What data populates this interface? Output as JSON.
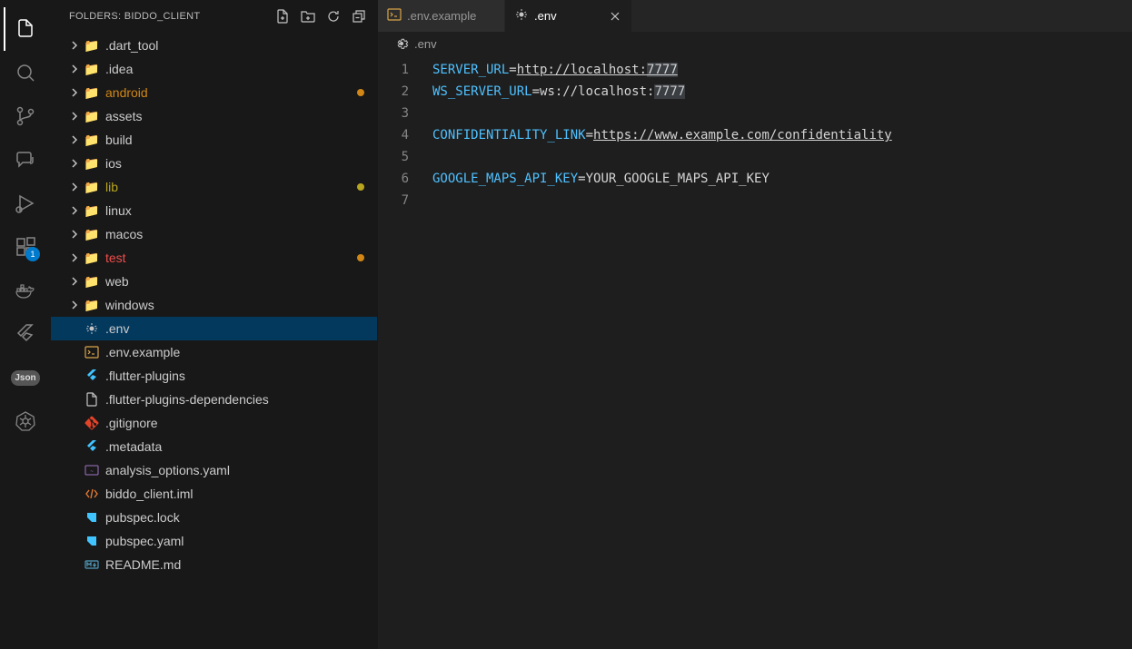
{
  "activity": {
    "extensions_badge": "1"
  },
  "sidebar": {
    "title": "FOLDERS: BIDDO_CLIENT",
    "folders": [
      {
        "label": ".dart_tool",
        "icon": "📁",
        "color": "",
        "dot": ""
      },
      {
        "label": ".idea",
        "icon": "📁",
        "color": "",
        "dot": ""
      },
      {
        "label": "android",
        "icon": "📁",
        "color": "fg-orange",
        "dot": "orange"
      },
      {
        "label": "assets",
        "icon": "📁",
        "color": "",
        "dot": ""
      },
      {
        "label": "build",
        "icon": "📁",
        "color": "",
        "dot": ""
      },
      {
        "label": "ios",
        "icon": "📁",
        "color": "",
        "dot": ""
      },
      {
        "label": "lib",
        "icon": "📁",
        "color": "fg-yellow",
        "dot": "yellow"
      },
      {
        "label": "linux",
        "icon": "📁",
        "color": "",
        "dot": ""
      },
      {
        "label": "macos",
        "icon": "📁",
        "color": "",
        "dot": ""
      },
      {
        "label": "test",
        "icon": "📁",
        "color": "fg-red",
        "dot": "orange"
      },
      {
        "label": "web",
        "icon": "📁",
        "color": "",
        "dot": ""
      },
      {
        "label": "windows",
        "icon": "📁",
        "color": "",
        "dot": ""
      }
    ],
    "files": [
      {
        "label": ".env",
        "selected": true
      },
      {
        "label": ".env.example",
        "selected": false
      },
      {
        "label": ".flutter-plugins",
        "selected": false
      },
      {
        "label": ".flutter-plugins-dependencies",
        "selected": false
      },
      {
        "label": ".gitignore",
        "selected": false
      },
      {
        "label": ".metadata",
        "selected": false
      },
      {
        "label": "analysis_options.yaml",
        "selected": false
      },
      {
        "label": "biddo_client.iml",
        "selected": false
      },
      {
        "label": "pubspec.lock",
        "selected": false
      },
      {
        "label": "pubspec.yaml",
        "selected": false
      },
      {
        "label": "README.md",
        "selected": false
      }
    ]
  },
  "tabs": [
    {
      "label": ".env.example",
      "active": false
    },
    {
      "label": ".env",
      "active": true
    }
  ],
  "breadcrumb": ".env",
  "code": {
    "lines": [
      {
        "n": "1",
        "key": "SERVER_URL",
        "eq": "=",
        "val": "http://localhost:",
        "hl": "7777",
        "link": true
      },
      {
        "n": "2",
        "key": "WS_SERVER_URL",
        "eq": "=",
        "val": "ws://localhost:",
        "hl": "7777",
        "link": false
      },
      {
        "n": "3",
        "key": "",
        "eq": "",
        "val": "",
        "hl": "",
        "link": false
      },
      {
        "n": "4",
        "key": "CONFIDENTIALITY_LINK",
        "eq": "=",
        "val": "https://www.example.com/confidentiality",
        "hl": "",
        "link": true
      },
      {
        "n": "5",
        "key": "",
        "eq": "",
        "val": "",
        "hl": "",
        "link": false
      },
      {
        "n": "6",
        "key": "GOOGLE_MAPS_API_KEY",
        "eq": "=",
        "val": "YOUR_GOOGLE_MAPS_API_KEY",
        "hl": "",
        "link": false
      },
      {
        "n": "7",
        "key": "",
        "eq": "",
        "val": "",
        "hl": "",
        "link": false
      }
    ]
  },
  "file_icons": {
    ".env": "gear",
    ".env.example": "terminal",
    ".flutter-plugins": "flutter",
    ".flutter-plugins-dependencies": "doc",
    ".gitignore": "git",
    ".metadata": "flutter",
    "analysis_options.yaml": "yaml",
    "biddo_client.iml": "xml",
    "pubspec.lock": "dart",
    "pubspec.yaml": "dart",
    "README.md": "md"
  }
}
